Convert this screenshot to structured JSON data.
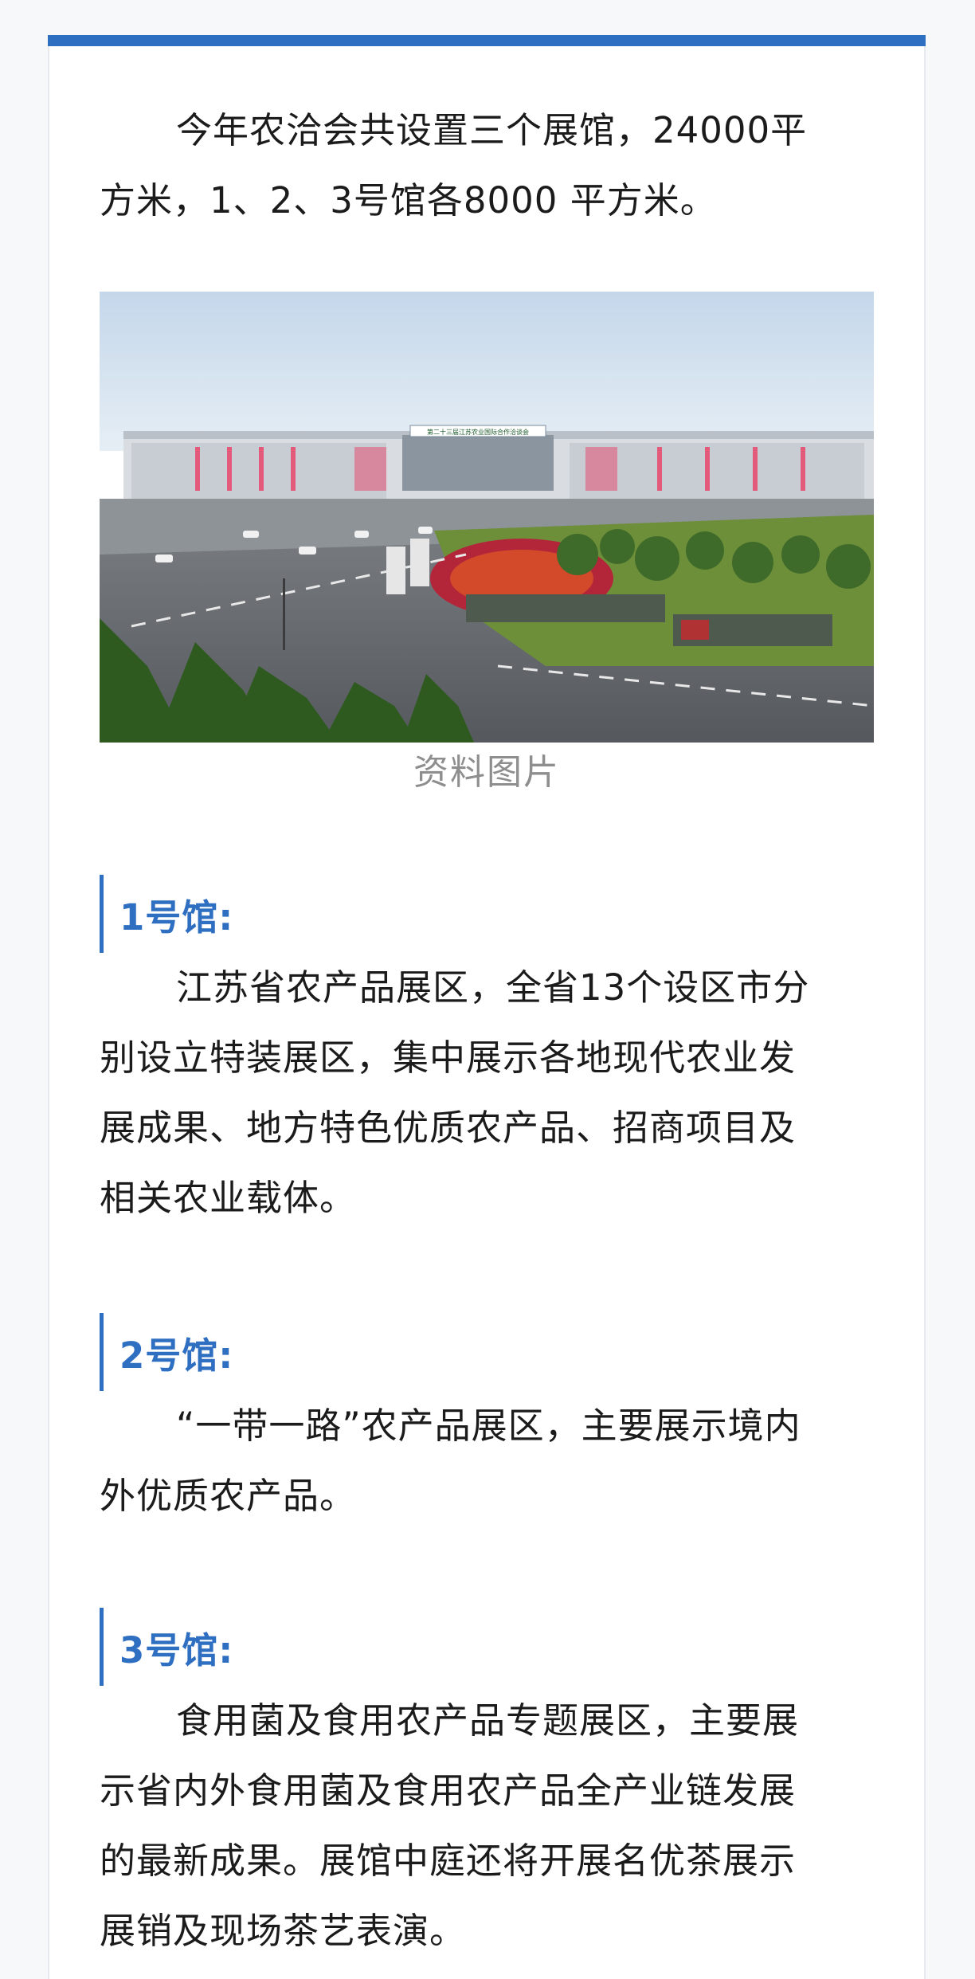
{
  "article": {
    "intro_line1": "今年农洽会共设置三个展馆，24000平",
    "intro_line2": "方米，1、2、3号馆各8000 平方米。",
    "photo_caption": "资料图片",
    "photo_sign": "第二十三届江苏农业国际合作洽谈会",
    "sections": [
      {
        "title": "1号馆:",
        "lines": [
          "江苏省农产品展区，全省13个设区市分",
          "别设立特装展区，集中展示各地现代农业发",
          "展成果、地方特色优质农产品、招商项目及",
          "相关农业载体。"
        ]
      },
      {
        "title": "2号馆:",
        "lines": [
          "“一带一路”农产品展区，主要展示境内",
          "外优质农产品。"
        ]
      },
      {
        "title": "3号馆:",
        "lines": [
          "食用菌及食用农产品专题展区，主要展",
          "示省内外食用菌及食用农产品全产业链发展",
          "的最新成果。展馆中庭还将开展名优茶展示",
          "展销及现场茶艺表演。"
        ]
      }
    ]
  },
  "colors": {
    "accent": "#2f6fc2",
    "text": "#1b1b1b",
    "caption": "#8e8e8e"
  }
}
